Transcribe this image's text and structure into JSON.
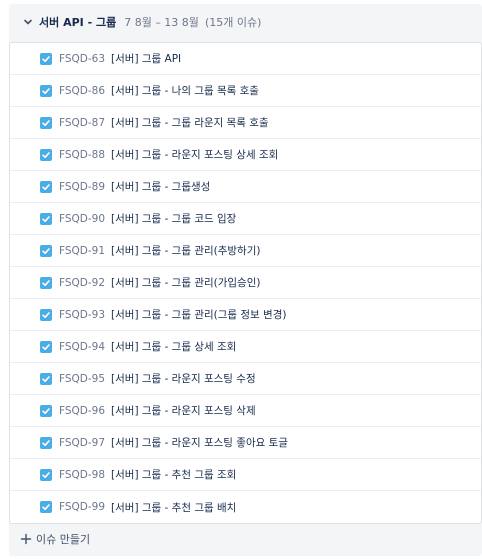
{
  "sprint": {
    "title": "서버 API - 그룹",
    "dates": "7 8월 – 13 8월",
    "issue_count": "(15개 이슈)"
  },
  "issue_type_icon": "checkbox-task-icon",
  "accent_color": "#4bade8",
  "issues": [
    {
      "key": "FSQD-63",
      "summary": "[서버] 그룹 API"
    },
    {
      "key": "FSQD-86",
      "summary": "[서버] 그룹 - 나의 그룹 목록 호출"
    },
    {
      "key": "FSQD-87",
      "summary": "[서버] 그룹 - 그룹 라운지 목록 호출"
    },
    {
      "key": "FSQD-88",
      "summary": "[서버] 그룹 - 라운지 포스팅 상세 조회"
    },
    {
      "key": "FSQD-89",
      "summary": "[서버] 그룹 - 그룹생성"
    },
    {
      "key": "FSQD-90",
      "summary": "[서버] 그룹 - 그룹 코드 입장"
    },
    {
      "key": "FSQD-91",
      "summary": "[서버] 그룹 - 그룹 관리(추방하기)"
    },
    {
      "key": "FSQD-92",
      "summary": "[서버] 그룹 - 그룹 관리(가입승인)"
    },
    {
      "key": "FSQD-93",
      "summary": "[서버] 그룹 - 그룹 관리(그룹 정보 변경)"
    },
    {
      "key": "FSQD-94",
      "summary": "[서버] 그룹 - 그룹 상세 조회"
    },
    {
      "key": "FSQD-95",
      "summary": "[서버] 그룹 - 라운지 포스팅 수정"
    },
    {
      "key": "FSQD-96",
      "summary": "[서버] 그룹 - 라운지 포스팅 삭제"
    },
    {
      "key": "FSQD-97",
      "summary": "[서버] 그룹 - 라운지 포스팅 좋아요 토글"
    },
    {
      "key": "FSQD-98",
      "summary": "[서버] 그룹 - 추천 그룹 조회"
    },
    {
      "key": "FSQD-99",
      "summary": "[서버] 그룹 - 추천 그룹 배치"
    }
  ],
  "create_issue": {
    "label": "이슈 만들기"
  }
}
